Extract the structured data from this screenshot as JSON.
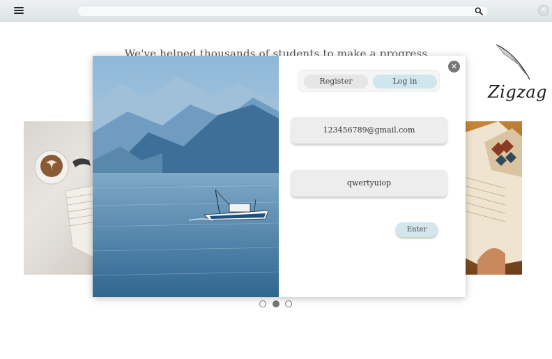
{
  "topbar": {
    "search_placeholder": "",
    "icons": {
      "menu": "menu-icon",
      "search": "search-icon",
      "close": "close-icon"
    },
    "close_glyph": "✕"
  },
  "hero": {
    "headline": "We've helped thousands of students to make a progress"
  },
  "logo": {
    "text": "Zigzag",
    "icon": "feather-icon"
  },
  "carousel": {
    "slides": 3,
    "active_index": 1
  },
  "modal": {
    "close_glyph": "✕",
    "tabs": [
      {
        "label": "Register",
        "active": false
      },
      {
        "label": "Log in",
        "active": true
      }
    ],
    "email_value": "123456789@gmail.com",
    "password_value": "qwertyuiop",
    "enter_label": "Enter"
  },
  "colors": {
    "accent": "#cfe6ec",
    "field_bg": "#ededed",
    "topbar": "#e4e8ea"
  }
}
